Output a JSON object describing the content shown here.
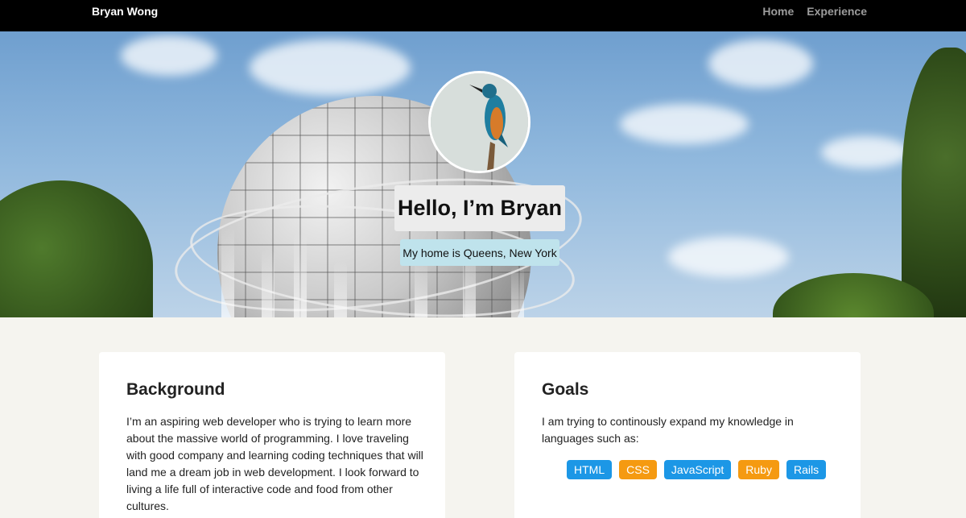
{
  "nav": {
    "brand": "Bryan Wong",
    "links": [
      "Home",
      "Experience"
    ]
  },
  "hero": {
    "greeting": "Hello, I’m Bryan",
    "location": "My home is Queens, New York"
  },
  "background": {
    "title": "Background",
    "text": "I’m an aspiring web developer who is trying to learn more about the massive world of programming. I love traveling with good company and learning coding techniques that will land me a dream job in web development. I look forward to living a life full of interactive code and food from other cultures."
  },
  "goals": {
    "title": "Goals",
    "text": "I am trying to continously expand my knowledge in languages such as:",
    "tags": [
      "HTML",
      "CSS",
      "JavaScript",
      "Ruby",
      "Rails"
    ]
  },
  "colors": {
    "navbar": "#000000",
    "tag_blue": "#1c97e6",
    "tag_orange": "#f59a11",
    "location_badge": "#bfe3ec"
  }
}
